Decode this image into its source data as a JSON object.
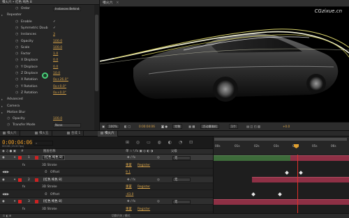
{
  "effect_controls": {
    "tab_label": "噴火六 • 红色 纯色 8",
    "rows": [
      {
        "label": "Order",
        "value_text": "Instances Behind",
        "kind": "dropdown",
        "indent": 1
      },
      {
        "label": "Repeater",
        "kind": "group",
        "indent": 0
      },
      {
        "label": "Enable",
        "value_text": "✓",
        "kind": "check",
        "indent": 1
      },
      {
        "label": "Symmetric Doub",
        "value_text": "✓",
        "kind": "check",
        "indent": 1
      },
      {
        "label": "Instances",
        "value_text": "3",
        "kind": "value",
        "indent": 1
      },
      {
        "label": "Opacity",
        "value_text": "100.0",
        "kind": "value",
        "indent": 1
      },
      {
        "label": "Scale",
        "value_text": "100.0",
        "kind": "value",
        "indent": 1
      },
      {
        "label": "Factor",
        "value_text": "1.0",
        "kind": "value",
        "indent": 1
      },
      {
        "label": "X Displace",
        "value_text": "0.0",
        "kind": "value",
        "indent": 1
      },
      {
        "label": "Y Displace",
        "value_text": "0.0",
        "kind": "value",
        "indent": 1
      },
      {
        "label": "Z Displace",
        "value_text": "10.0",
        "kind": "value",
        "indent": 1
      },
      {
        "label": "X Rotation",
        "value_text": "0x+26.0°",
        "kind": "value",
        "indent": 1
      },
      {
        "label": "Y Rotation",
        "value_text": "0x+0.0°",
        "kind": "value",
        "indent": 1
      },
      {
        "label": "Z Rotation",
        "value_text": "0x+0.0°",
        "kind": "value",
        "indent": 1
      },
      {
        "label": "Advanced",
        "kind": "group",
        "indent": 0
      },
      {
        "label": "Camera",
        "kind": "group",
        "indent": 0
      },
      {
        "label": "Motion Blur",
        "kind": "group",
        "indent": 0
      },
      {
        "label": "Opacity",
        "value_text": "100.0",
        "kind": "value",
        "indent": 0
      },
      {
        "label": "Transfer Mode",
        "value_text": "None",
        "kind": "dropdown",
        "indent": 0
      }
    ]
  },
  "viewer": {
    "tab_label": "噴火六",
    "watermark": "CGzixue.cn",
    "bar": {
      "zoom": "100%",
      "timecode": "0:00:04:06",
      "resolution": "完整",
      "camera": "活动摄像机",
      "views": "1个",
      "exposure": "+0.0"
    }
  },
  "timeline": {
    "tabs": [
      {
        "label": "噴火六",
        "active": false
      },
      {
        "label": "噴火五",
        "active": false
      },
      {
        "label": "合成 1",
        "active": false
      },
      {
        "label": "噴火六",
        "active": true
      }
    ],
    "timecode": "0:00:04:06",
    "fps_note": "00106 (25.00 fps)",
    "search_placeholder": "",
    "columns": {
      "source_name": "图层名称",
      "switches": "单 ☆ \\ fx ▣ ◎ ◐ ◑",
      "parent": "父级"
    },
    "ruler": [
      "00s",
      "01s",
      "02s",
      "03s",
      "04s",
      "05s",
      "06s"
    ],
    "layers": [
      {
        "type": "layer",
        "num": "1",
        "name": "[红色 纯色 8]",
        "parent": "无",
        "selected": true
      },
      {
        "type": "sub",
        "label": "3D Stroke",
        "mode": "重置",
        "mode2": "Register"
      },
      {
        "type": "sub2",
        "label": "Offset",
        "value": "9.1"
      },
      {
        "type": "layer",
        "num": "2",
        "name": "[红色 纯色 8]",
        "parent": "无",
        "selected": false
      },
      {
        "type": "sub",
        "label": "3D Stroke",
        "mode": "重置",
        "mode2": "Register"
      },
      {
        "type": "sub2",
        "label": "Offset",
        "value": "-43.0"
      },
      {
        "type": "layer",
        "num": "3",
        "name": "[红色 纯色 8]",
        "parent": "无",
        "selected": false
      },
      {
        "type": "sub",
        "label": "3D Stroke",
        "mode": "重置",
        "mode2": "Register"
      }
    ],
    "status_text": "切换开关 / 模式"
  }
}
